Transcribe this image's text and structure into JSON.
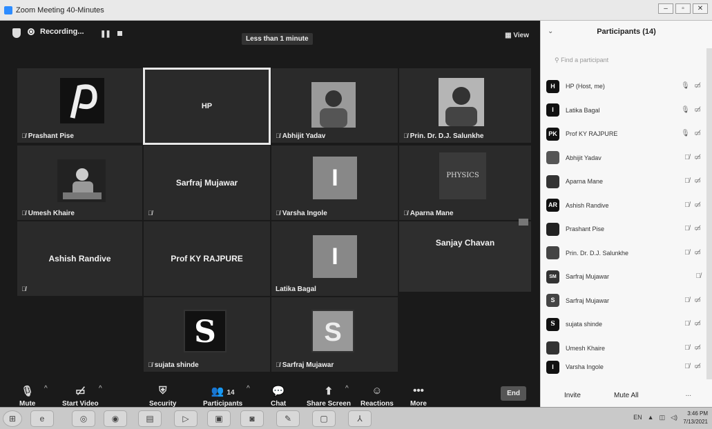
{
  "window": {
    "title": "Zoom Meeting 40-Minutes",
    "controls": [
      "–",
      "▫",
      "✕"
    ]
  },
  "meeting": {
    "recording_label": "Recording...",
    "timer": "Less than 1 minute",
    "view_label": "View",
    "tiles": [
      {
        "name": "Prashant Pise",
        "kind": "photo",
        "muted": true
      },
      {
        "name": "HP",
        "kind": "label",
        "active": true
      },
      {
        "name": "Abhijit Yadav",
        "kind": "photo",
        "muted": true
      },
      {
        "name": "Prin. Dr. D.J. Salunkhe",
        "kind": "photo",
        "muted": true
      },
      {
        "name": "Umesh Khaire",
        "kind": "photo",
        "muted": true
      },
      {
        "name": "Sarfraj Mujawar",
        "kind": "label",
        "muted": true
      },
      {
        "name": "Varsha Ingole",
        "kind": "initial",
        "initial": "I",
        "muted": true
      },
      {
        "name": "Aparna Mane",
        "kind": "photo",
        "photo_text": "PHYSICS",
        "muted": true
      },
      {
        "name": "Ashish Randive",
        "kind": "label",
        "muted": true
      },
      {
        "name": "Prof KY RAJPURE",
        "kind": "label"
      },
      {
        "name": "Latika Bagal",
        "kind": "initial",
        "initial": "I"
      },
      {
        "name": "Sanjay Chavan",
        "kind": "label"
      },
      {
        "name": "sujata shinde",
        "kind": "initial",
        "initial": "S",
        "muted": true
      },
      {
        "name": "Sarfraj Mujawar",
        "kind": "initial",
        "initial": "S",
        "muted": true
      }
    ]
  },
  "toolbar": {
    "mute": "Mute",
    "start_video": "Start Video",
    "security": "Security",
    "participants": "Participants",
    "participants_count": "14",
    "chat": "Chat",
    "share_screen": "Share Screen",
    "reactions": "Reactions",
    "more": "More",
    "end": "End"
  },
  "panel": {
    "title": "Participants (14)",
    "search_placeholder": "Find a participant",
    "participants": [
      {
        "initials": "H",
        "name": "HP (Host, me)"
      },
      {
        "initials": "I",
        "name": "Latika Bagal"
      },
      {
        "initials": "PK",
        "name": "Prof KY RAJPURE"
      },
      {
        "initials": "",
        "name": "Abhijit Yadav"
      },
      {
        "initials": "",
        "name": "Aparna Mane"
      },
      {
        "initials": "AR",
        "name": "Ashish Randive"
      },
      {
        "initials": "",
        "name": "Prashant Pise"
      },
      {
        "initials": "",
        "name": "Prin. Dr. D.J. Salunkhe"
      },
      {
        "initials": "SM",
        "name": "Sarfraj Mujawar"
      },
      {
        "initials": "S",
        "name": "Sarfraj Mujawar"
      },
      {
        "initials": "S",
        "name": "sujata shinde"
      },
      {
        "initials": "",
        "name": "Umesh Khaire"
      },
      {
        "initials": "I",
        "name": "Varsha Ingole"
      }
    ],
    "invite": "Invite",
    "mute_all": "Mute All",
    "more": "..."
  },
  "taskbar": {
    "lang": "EN",
    "time": "3:46 PM",
    "date": "7/13/2021"
  }
}
